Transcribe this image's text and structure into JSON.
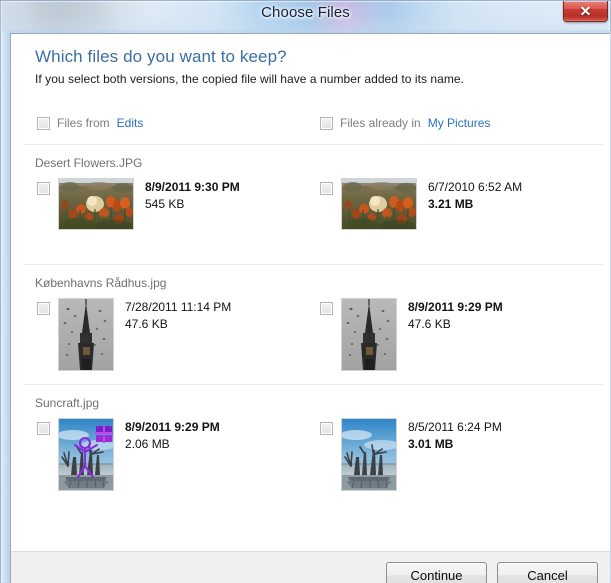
{
  "window": {
    "title": "Choose Files",
    "close_label": "✕",
    "close_icon": "close-icon"
  },
  "dialog": {
    "heading": "Which files do you want to keep?",
    "subheading": "If you select both versions, the copied file will have a number added to its name.",
    "columns": [
      {
        "label": "Files from ",
        "link": "Edits"
      },
      {
        "label": "Files already in ",
        "link": "My Pictures"
      }
    ]
  },
  "groups": [
    {
      "name": "Desert Flowers.JPG",
      "thumb_kind": "desert-flowers",
      "left": {
        "date": "8/9/2011 9:30 PM",
        "size": "545 KB",
        "date_bold": true,
        "size_bold": false,
        "edited": false
      },
      "right": {
        "date": "6/7/2010 6:52 AM",
        "size": "3.21 MB",
        "date_bold": false,
        "size_bold": true,
        "edited": false
      }
    },
    {
      "name": "Københavns Rådhus.jpg",
      "thumb_kind": "radhus",
      "left": {
        "date": "7/28/2011 11:14 PM",
        "size": "47.6 KB",
        "date_bold": false,
        "size_bold": false,
        "edited": false
      },
      "right": {
        "date": "8/9/2011 9:29 PM",
        "size": "47.6 KB",
        "date_bold": true,
        "size_bold": false,
        "edited": false
      }
    },
    {
      "name": "Suncraft.jpg",
      "thumb_kind": "suncraft",
      "left": {
        "date": "8/9/2011 9:29 PM",
        "size": "2.06 MB",
        "date_bold": true,
        "size_bold": false,
        "edited": true
      },
      "right": {
        "date": "8/5/2011 6:24 PM",
        "size": "3.01 MB",
        "date_bold": false,
        "size_bold": true,
        "edited": false
      }
    }
  ],
  "footer": {
    "continue_label": "Continue",
    "cancel_label": "Cancel"
  },
  "colors": {
    "heading": "#3a6ea5",
    "link": "#2a6ec0",
    "group_name": "#6f6f6f",
    "close_button": "#c63c34",
    "footer_bg": "#f0f0f0"
  }
}
